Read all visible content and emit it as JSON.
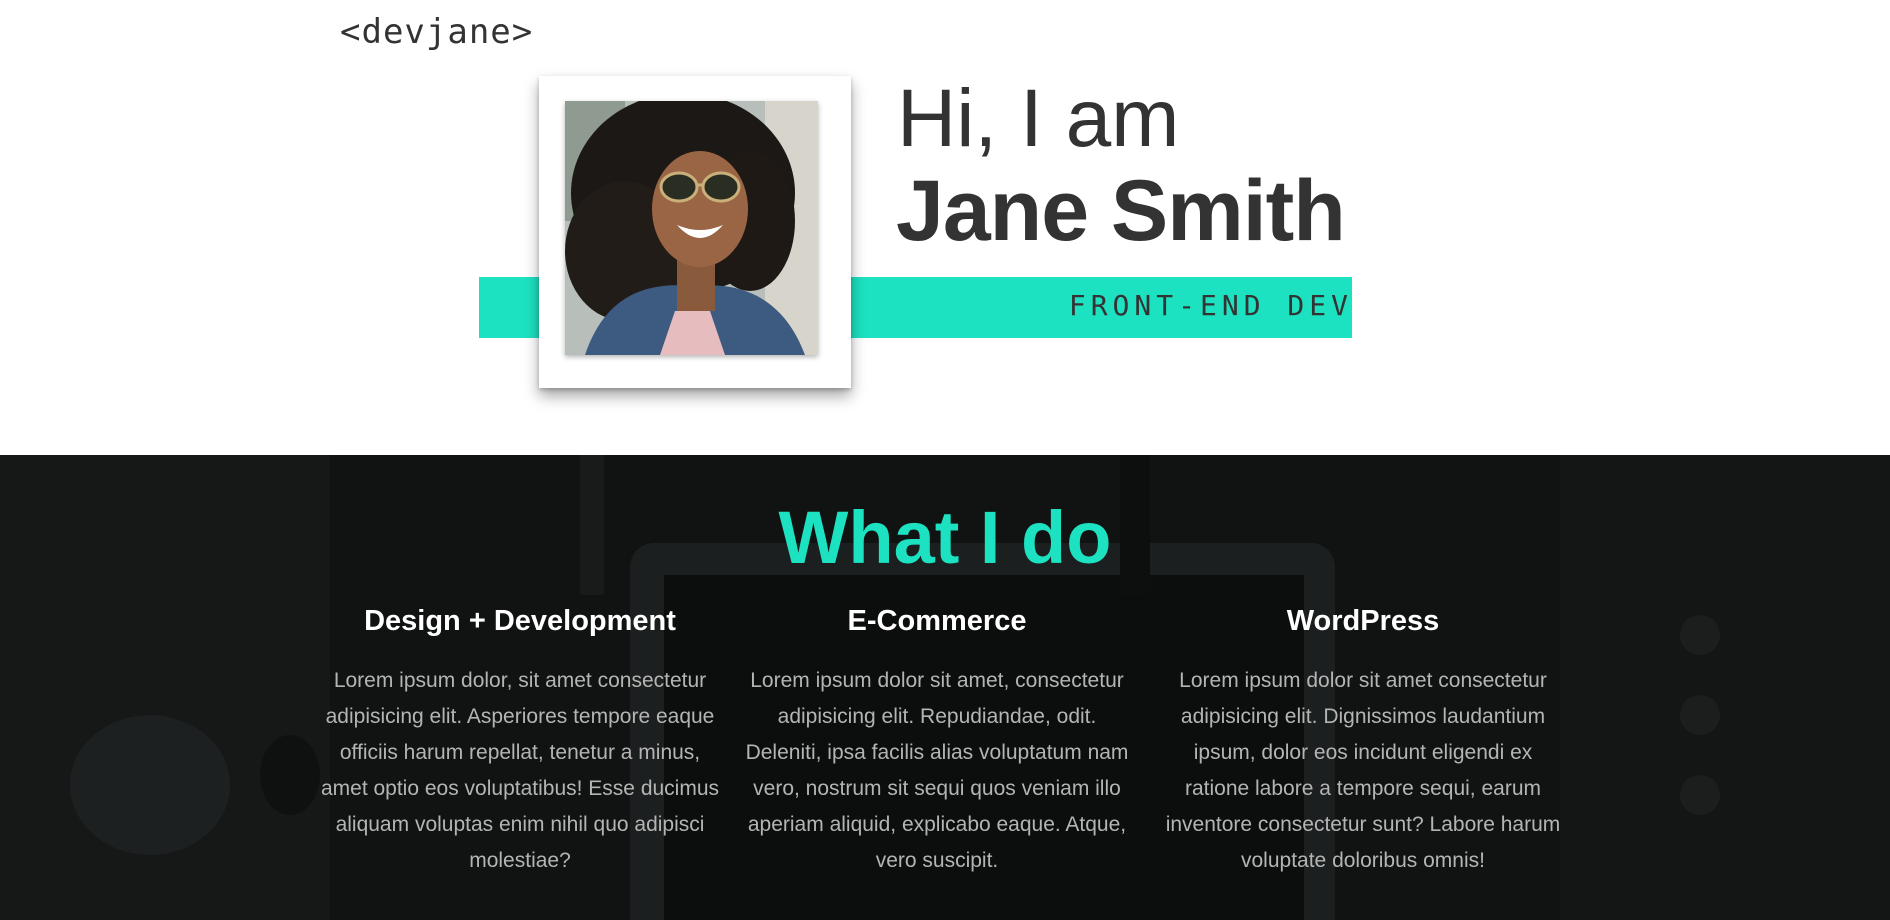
{
  "header": {
    "logo": "<devjane>"
  },
  "hero": {
    "greeting": "Hi, I am",
    "name": "Jane Smith",
    "role": "FRONT-END DEV",
    "accent_color": "#1de2c1",
    "photo_alt": "portrait-photo"
  },
  "services": {
    "title": "What I do",
    "items": [
      {
        "title": "Design + Development",
        "text": "Lorem ipsum dolor, sit amet consectetur adipisicing elit. Asperiores tempore eaque officiis harum repellat, tenetur a minus, amet optio eos voluptatibus! Esse ducimus aliquam voluptas enim nihil quo adipisci molestiae?"
      },
      {
        "title": "E-Commerce",
        "text": "Lorem ipsum dolor sit amet, consectetur adipisicing elit. Repudiandae, odit. Deleniti, ipsa facilis alias voluptatum nam vero, nostrum sit sequi quos veniam illo aperiam aliquid, explicabo eaque. Atque, vero suscipit."
      },
      {
        "title": "WordPress",
        "text": "Lorem ipsum dolor sit amet consectetur adipisicing elit. Dignissimos laudantium ipsum, dolor eos incidunt eligendi ex ratione labore a tempore sequi, earum inventore consectetur sunt? Labore harum voluptate doloribus omnis!"
      }
    ]
  }
}
